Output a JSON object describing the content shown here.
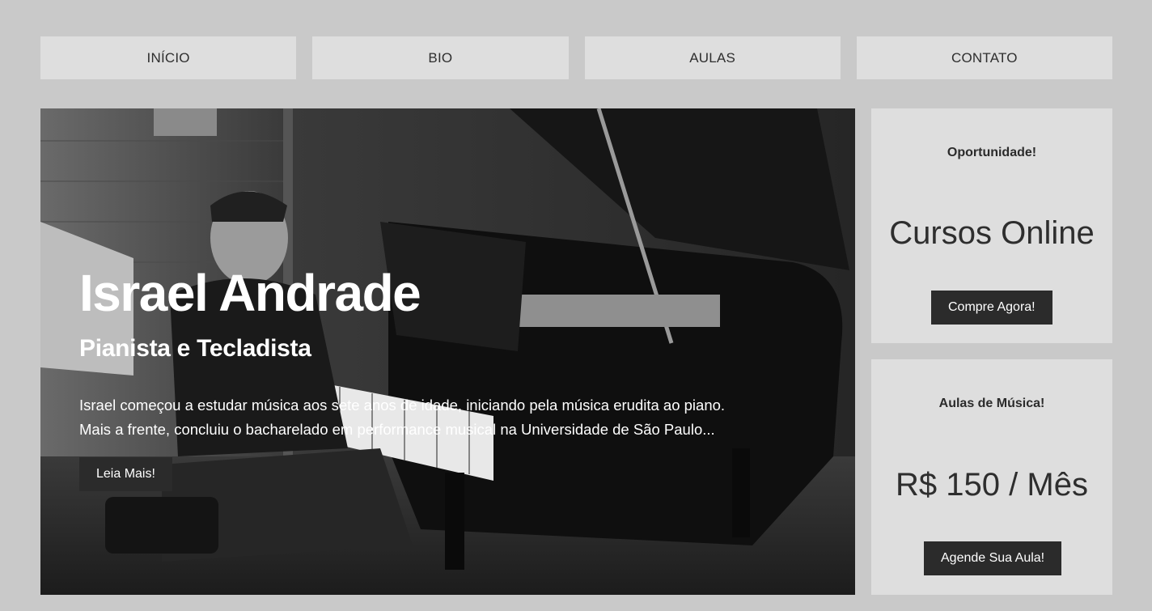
{
  "nav": {
    "items": [
      {
        "label": "INÍCIO"
      },
      {
        "label": "BIO"
      },
      {
        "label": "AULAS"
      },
      {
        "label": "CONTATO"
      }
    ]
  },
  "hero": {
    "title": "Israel Andrade",
    "subtitle": "Pianista e Tecladista",
    "text_line1": "Israel começou a estudar música aos sete anos de idade, iniciando pela música erudita ao piano.",
    "text_line2": "Mais a frente, concluiu o bacharelado em performance musical na Universidade de São Paulo...",
    "button_label": "Leia Mais!"
  },
  "cards": [
    {
      "label": "Oportunidade!",
      "headline": "Cursos Online",
      "button_label": "Compre Agora!"
    },
    {
      "label": "Aulas de Música!",
      "headline": "R$ 150 / Mês",
      "button_label": "Agende Sua Aula!"
    }
  ],
  "colors": {
    "page_bg": "#c9c9c9",
    "panel_bg": "#dedede",
    "button_bg": "#2b2b2b",
    "text": "#2e2e2e"
  }
}
